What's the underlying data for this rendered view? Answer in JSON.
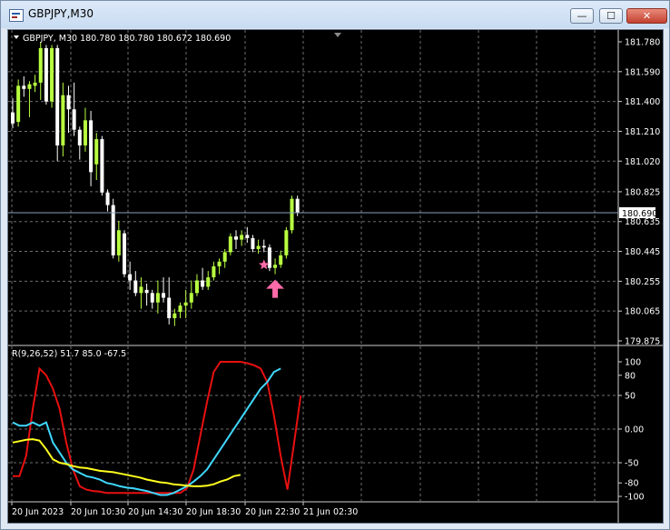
{
  "window": {
    "title": "GBPJPY,M30"
  },
  "buttons": {
    "minimize": "—",
    "maximize": "☐",
    "close": "✕"
  },
  "main": {
    "header": "GBPJPY, M30  180.780  180.780  180.672  180.690",
    "current_price": "180.690",
    "price_ticks": [
      "181.780",
      "181.590",
      "181.400",
      "181.210",
      "181.020",
      "180.825",
      "180.635",
      "180.445",
      "180.255",
      "180.065",
      "179.875"
    ]
  },
  "indicator": {
    "header": "R(9,26,52)  51.7  85.0  -67.5",
    "levels": [
      "100",
      "80",
      "50",
      "0.00",
      "-50",
      "-80",
      "-100"
    ]
  },
  "time_ticks": [
    "20 Jun 2023",
    "20 Jun 10:30",
    "20 Jun 14:30",
    "20 Jun 18:30",
    "20 Jun 22:30",
    "21 Jun 02:30"
  ],
  "colors": {
    "bull": "#b8ff40",
    "bear": "#ffffff",
    "red_line": "#e81010",
    "cyan_line": "#40d8ff",
    "yellow_line": "#ffff20",
    "marker": "#ff6aa8",
    "grid": "#c8c8c8"
  },
  "chart_data": [
    {
      "type": "candlestick",
      "symbol": "GBPJPY",
      "timeframe": "M30",
      "ylim": [
        179.875,
        181.78
      ],
      "candles": [
        [
          181.33,
          181.42,
          181.23,
          181.26
        ],
        [
          181.27,
          181.54,
          181.24,
          181.5
        ],
        [
          181.5,
          181.56,
          181.43,
          181.48
        ],
        [
          181.48,
          181.53,
          181.3,
          181.51
        ],
        [
          181.5,
          181.57,
          181.46,
          181.52
        ],
        [
          181.52,
          181.78,
          181.41,
          181.74
        ],
        [
          181.74,
          181.76,
          181.38,
          181.4
        ],
        [
          181.4,
          181.76,
          181.36,
          181.74
        ],
        [
          181.74,
          181.76,
          181.02,
          181.12
        ],
        [
          181.12,
          181.52,
          181.05,
          181.44
        ],
        [
          181.44,
          181.5,
          181.2,
          181.35
        ],
        [
          181.35,
          181.52,
          181.18,
          181.22
        ],
        [
          181.22,
          181.24,
          181.03,
          181.12
        ],
        [
          181.12,
          181.36,
          181.08,
          181.28
        ],
        [
          181.28,
          181.34,
          180.86,
          180.95
        ],
        [
          181.0,
          181.2,
          180.9,
          181.16
        ],
        [
          181.16,
          181.18,
          180.8,
          180.82
        ],
        [
          180.82,
          180.84,
          180.7,
          180.74
        ],
        [
          180.74,
          180.78,
          180.4,
          180.42
        ],
        [
          180.42,
          180.64,
          180.38,
          180.58
        ],
        [
          180.56,
          180.58,
          180.28,
          180.3
        ],
        [
          180.3,
          180.38,
          180.2,
          180.26
        ],
        [
          180.26,
          180.32,
          180.16,
          180.18
        ],
        [
          180.18,
          180.28,
          180.08,
          180.22
        ],
        [
          180.2,
          180.24,
          180.1,
          180.18
        ],
        [
          180.18,
          180.2,
          180.08,
          180.12
        ],
        [
          180.12,
          180.26,
          180.05,
          180.18
        ],
        [
          180.18,
          180.28,
          180.12,
          180.15
        ],
        [
          180.15,
          180.28,
          179.98,
          180.02
        ],
        [
          180.02,
          180.08,
          179.97,
          180.05
        ],
        [
          180.06,
          180.12,
          180.02,
          180.1
        ],
        [
          180.1,
          180.2,
          180.02,
          180.12
        ],
        [
          180.12,
          180.26,
          180.08,
          180.18
        ],
        [
          180.18,
          180.3,
          180.16,
          180.26
        ],
        [
          180.26,
          180.34,
          180.2,
          180.22
        ],
        [
          180.22,
          180.32,
          180.2,
          180.28
        ],
        [
          180.28,
          180.38,
          180.26,
          180.35
        ],
        [
          180.35,
          180.4,
          180.3,
          180.38
        ],
        [
          180.38,
          180.46,
          180.34,
          180.44
        ],
        [
          180.44,
          180.56,
          180.42,
          180.54
        ],
        [
          180.54,
          180.58,
          180.46,
          180.52
        ],
        [
          180.52,
          180.58,
          180.48,
          180.55
        ],
        [
          180.55,
          180.6,
          180.5,
          180.53
        ],
        [
          180.53,
          180.55,
          180.44,
          180.46
        ],
        [
          180.46,
          180.52,
          180.43,
          180.48
        ],
        [
          180.48,
          180.52,
          180.44,
          180.47
        ],
        [
          180.47,
          180.49,
          180.32,
          180.34
        ],
        [
          180.34,
          180.4,
          180.3,
          180.36
        ],
        [
          180.36,
          180.45,
          180.34,
          180.42
        ],
        [
          180.42,
          180.6,
          180.4,
          180.58
        ],
        [
          180.58,
          180.8,
          180.56,
          180.78
        ],
        [
          180.78,
          180.8,
          180.67,
          180.69
        ]
      ],
      "markers": [
        {
          "index": 45,
          "shape": "star"
        },
        {
          "index": 47,
          "shape": "up-arrow"
        }
      ]
    },
    {
      "type": "line",
      "ylim": [
        -100,
        100
      ],
      "series": [
        {
          "values": [
            -70,
            -70,
            -40,
            30,
            90,
            80,
            60,
            30,
            -20,
            -60,
            -85,
            -90,
            -92,
            -93,
            -95,
            -95,
            -95,
            -95,
            -95,
            -95,
            -95,
            -95,
            -95,
            -95,
            -95,
            -95,
            -88,
            -60,
            -10,
            40,
            85,
            100,
            100,
            100,
            100,
            98,
            95,
            90,
            70,
            20,
            -40,
            -90,
            -20,
            50
          ]
        },
        {
          "values": [
            10,
            5,
            5,
            10,
            5,
            10,
            -20,
            -35,
            -50,
            -60,
            -65,
            -70,
            -72,
            -75,
            -80,
            -82,
            -85,
            -87,
            -88,
            -90,
            -92,
            -95,
            -98,
            -98,
            -95,
            -90,
            -85,
            -78,
            -70,
            -60,
            -45,
            -30,
            -15,
            0,
            15,
            30,
            45,
            60,
            70,
            85,
            90
          ]
        },
        {
          "values": [
            -20,
            -18,
            -16,
            -15,
            -17,
            -30,
            -45,
            -50,
            -52,
            -55,
            -57,
            -58,
            -60,
            -62,
            -63,
            -64,
            -66,
            -68,
            -70,
            -72,
            -75,
            -77,
            -79,
            -80,
            -82,
            -83,
            -84,
            -85,
            -85,
            -84,
            -82,
            -78,
            -75,
            -70,
            -68
          ]
        }
      ]
    }
  ]
}
